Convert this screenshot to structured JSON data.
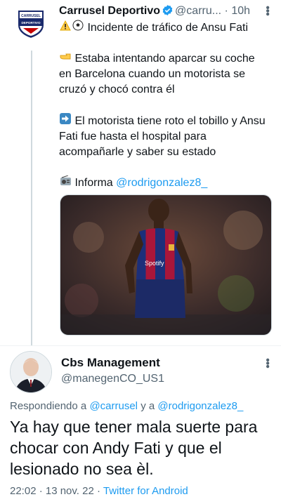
{
  "tweet": {
    "avatar_text": [
      "CARRUSEL",
      "DEPORTIVO"
    ],
    "name": "Carrusel Deportivo",
    "handle": "@carru...",
    "separator": "·",
    "time": "10h",
    "line1_text": "Incidente de tráfico de Ansu Fati",
    "para1": "Estaba intentando aparcar su coche en Barcelona cuando un motorista se cruzó y chocó contra él",
    "para2": "El motorista tiene roto el tobillo y Ansu Fati fue hasta el hospital para acompañarle y saber su estado",
    "informa_label": "Informa",
    "informa_mention": "@rodrigonzalez8_",
    "sponsor_text": "Spotify"
  },
  "reply": {
    "name": "Cbs Management",
    "handle": "@manegenCO_US1",
    "replying_prefix": "Respondiendo a",
    "replying_user1": "@carrusel",
    "replying_and": "y a",
    "replying_user2": "@rodrigonzalez8_",
    "text": "Ya hay que tener mala suerte para chocar con Andy Fati y que el lesionado no sea èl.",
    "date": "22:02 · 13 nov. 22 ·",
    "source": "Twitter for Android"
  },
  "colors": {
    "link": "#1d9bf0",
    "secondary": "#536471",
    "verified": "#1d9bf0"
  }
}
